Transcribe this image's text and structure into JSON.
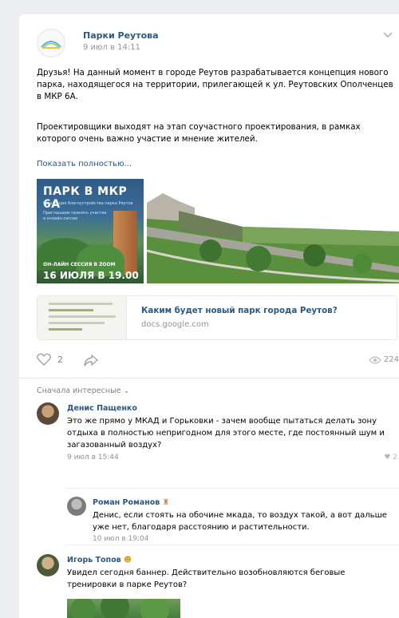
{
  "post": {
    "group_name": "Парки Реутова",
    "date": "9 июл в 14:11",
    "paragraph1": "Друзья! На данный момент в городе Реутов разрабатывается концепция нового парка, находящегося на территории, прилегающей к ул. Реутовских Ополченцев в МКР 6А.",
    "paragraph2": "Проектировщики выходят на этап соучастного проектирования, в рамках которого очень важно участие и мнение жителей.",
    "show_more": "Показать полностью...",
    "banner": {
      "title": "ПАРК В МКР 6А",
      "subtitle1": "Концепция благоустройства парка Реутов",
      "subtitle2": "Приглашаем принять участие в онлайн-сессии",
      "caption1": "ОН-ЛАЙН СЕССИЯ В ZOOM",
      "caption2": "16 ИЮЛЯ В 19.00"
    },
    "link": {
      "title": "Каким будет новый парк города Реутов?",
      "domain": "docs.google.com"
    },
    "likes": "2",
    "views": "224"
  },
  "comments": {
    "sort_label": "Сначала интересные",
    "items": [
      {
        "author": "Денис Пащенко",
        "text_line1": "Это же прямо у МКАД и Горьковки - зачем вообще пытаться делать зону",
        "text_line2": "отдыха в полностью непригодном для этого месте, где постоянный шум и",
        "text_line3": "загазованный воздух?",
        "date": "9 июл в 15:44",
        "likes": "2"
      },
      {
        "author": "Роман Романов",
        "text_line1": "Денис, если стоять на обочине мкада, то воздух такой, а вот дальше",
        "text_line2": "уже нет, благодаря расстоянию и растительности.",
        "date": "10 июл в 19:04"
      },
      {
        "author": "Игорь Топов",
        "text_line1": "Увидел сегодня баннер. Действительно возобновляются беговые",
        "text_line2": "тренировки в парке Реутов?"
      }
    ]
  },
  "colors": {
    "link_blue": "#2a5885",
    "muted_gray": "#939393",
    "background": "#edeef0"
  }
}
